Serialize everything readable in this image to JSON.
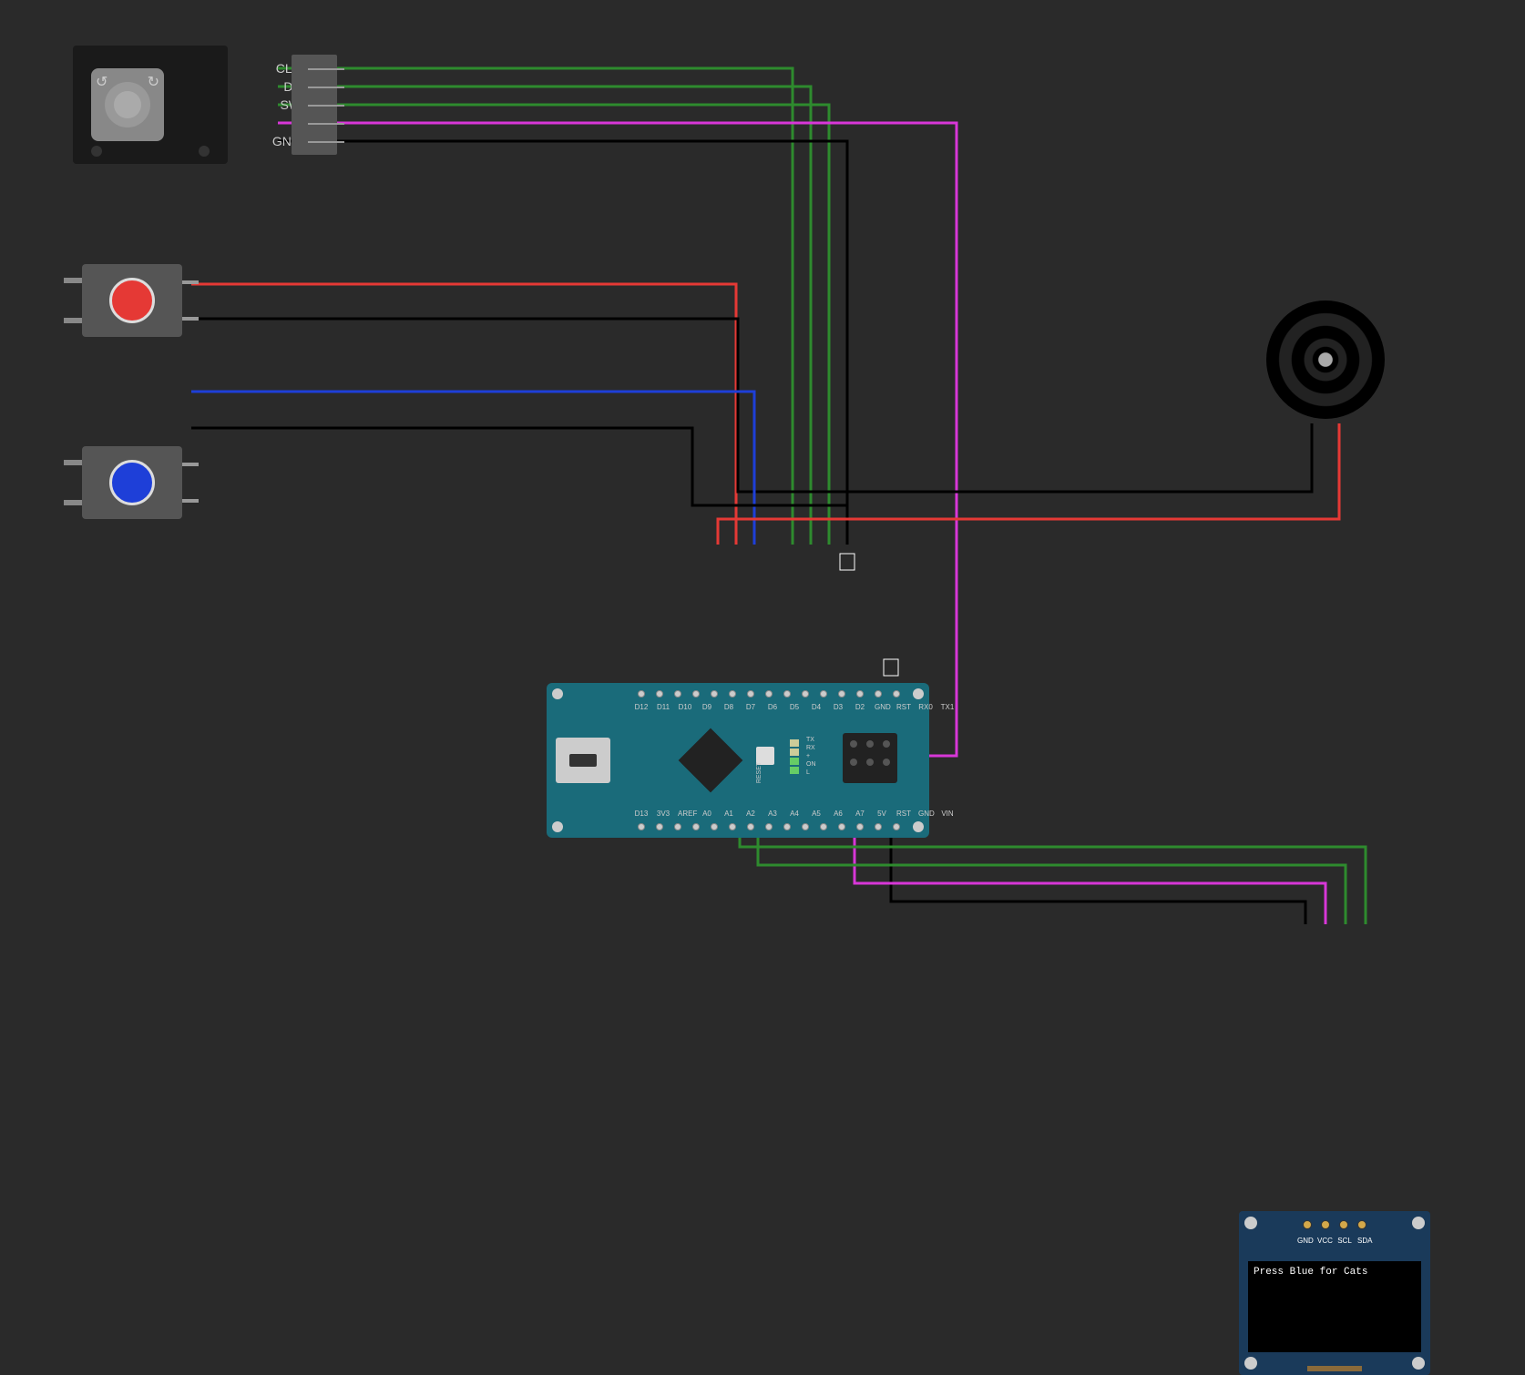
{
  "encoder": {
    "pins": [
      "CLK",
      "DT",
      "SW",
      "+",
      "GND"
    ]
  },
  "buttons": {
    "red": {
      "color": "#e53935",
      "name": "red-button"
    },
    "blue": {
      "color": "#1e3fd8",
      "name": "blue-button"
    }
  },
  "arduino": {
    "board": "Arduino Nano",
    "top_pins": [
      "D12",
      "D11",
      "D10",
      "D9",
      "D8",
      "D7",
      "D6",
      "D5",
      "D4",
      "D3",
      "D2",
      "GND",
      "RST",
      "RX0",
      "TX1"
    ],
    "bottom_pins": [
      "D13",
      "3V3",
      "AREF",
      "A0",
      "A1",
      "A2",
      "A3",
      "A4",
      "A5",
      "A6",
      "A7",
      "5V",
      "RST",
      "GND",
      "VIN"
    ],
    "side_labels": [
      "TX",
      "RX",
      "+",
      "ON",
      "L"
    ],
    "reset_label": "RESET"
  },
  "oled": {
    "pins": [
      "GND",
      "VCC",
      "SCL",
      "SDA"
    ],
    "display_text": "Press Blue for Cats"
  },
  "buzzer": {
    "name": "piezo-buzzer"
  },
  "wires": {
    "encoder_clk": {
      "color": "green",
      "from": "encoder.CLK",
      "to": "arduino.D4"
    },
    "encoder_dt": {
      "color": "green",
      "from": "encoder.DT",
      "to": "arduino.D3"
    },
    "encoder_sw": {
      "color": "green",
      "from": "encoder.SW",
      "to": "arduino.D2"
    },
    "encoder_vcc": {
      "color": "magenta",
      "from": "encoder.+",
      "to": "arduino.5V"
    },
    "encoder_gnd": {
      "color": "black",
      "from": "encoder.GND",
      "to": "arduino.GND_top"
    },
    "btn_red_sig": {
      "color": "red",
      "from": "btn_red.1",
      "to": "arduino.D7"
    },
    "btn_red_gnd": {
      "color": "black",
      "from": "btn_red.2",
      "to": "arduino.GND_top"
    },
    "btn_blue_sig": {
      "color": "blue",
      "from": "btn_blue.1",
      "to": "arduino.D6"
    },
    "btn_blue_gnd": {
      "color": "black",
      "from": "btn_blue.2",
      "to": "arduino.GND_top"
    },
    "buzzer_sig": {
      "color": "red",
      "from": "arduino.D8",
      "to": "buzzer.+"
    },
    "buzzer_gnd": {
      "color": "black",
      "from": "arduino.GND_top",
      "to": "buzzer.-"
    },
    "oled_gnd": {
      "color": "black",
      "from": "arduino.GND_bottom",
      "to": "oled.GND"
    },
    "oled_vcc": {
      "color": "magenta",
      "from": "arduino.5V",
      "to": "oled.VCC"
    },
    "oled_scl": {
      "color": "green",
      "from": "arduino.A5",
      "to": "oled.SCL"
    },
    "oled_sda": {
      "color": "green",
      "from": "arduino.A4",
      "to": "oled.SDA"
    }
  }
}
